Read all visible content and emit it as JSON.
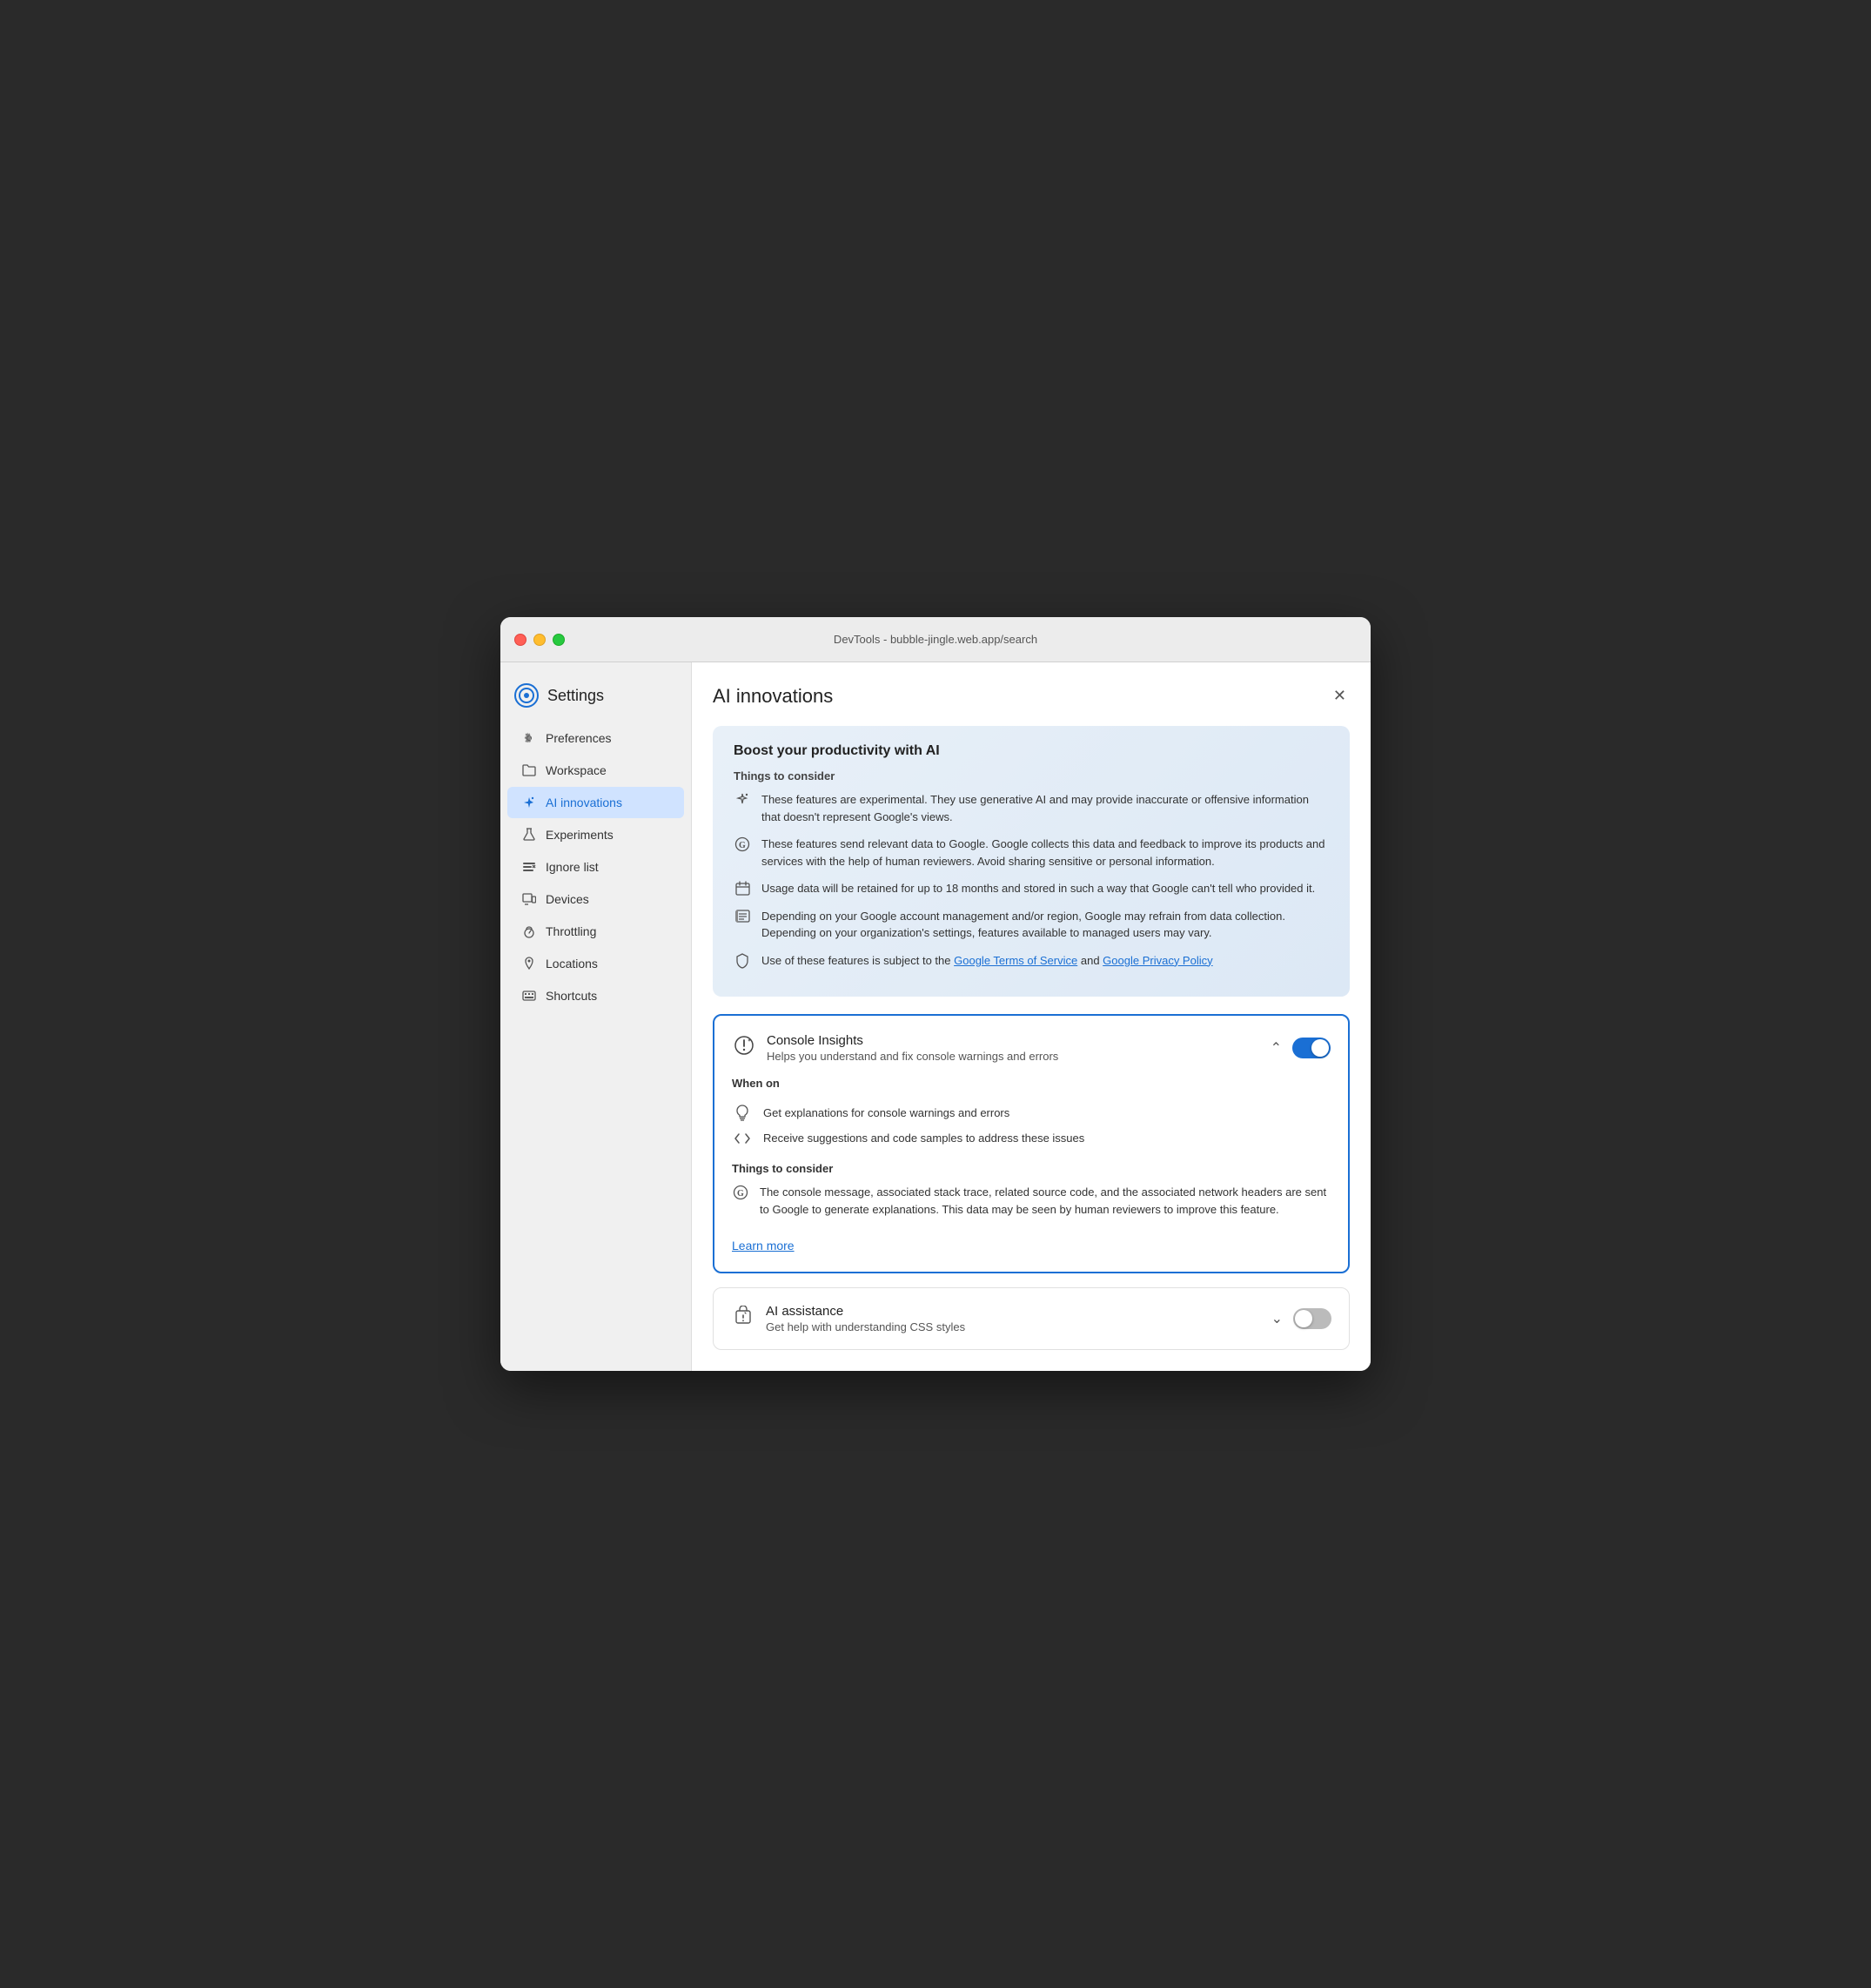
{
  "window": {
    "title": "DevTools - bubble-jingle.web.app/search"
  },
  "sidebar": {
    "heading": "Settings",
    "items": [
      {
        "id": "preferences",
        "label": "Preferences",
        "icon": "gear"
      },
      {
        "id": "workspace",
        "label": "Workspace",
        "icon": "folder"
      },
      {
        "id": "ai-innovations",
        "label": "AI innovations",
        "icon": "sparkle",
        "active": true
      },
      {
        "id": "experiments",
        "label": "Experiments",
        "icon": "flask"
      },
      {
        "id": "ignore-list",
        "label": "Ignore list",
        "icon": "ignore"
      },
      {
        "id": "devices",
        "label": "Devices",
        "icon": "devices"
      },
      {
        "id": "throttling",
        "label": "Throttling",
        "icon": "throttle"
      },
      {
        "id": "locations",
        "label": "Locations",
        "icon": "location"
      },
      {
        "id": "shortcuts",
        "label": "Shortcuts",
        "icon": "keyboard"
      }
    ]
  },
  "main": {
    "title": "AI innovations",
    "info_box": {
      "title": "Boost your productivity with AI",
      "things_to_consider": "Things to consider",
      "items": [
        {
          "text": "These features are experimental. They use generative AI and may provide inaccurate or offensive information that doesn't represent Google's views.",
          "icon": "sparkle-icon"
        },
        {
          "text": "These features send relevant data to Google. Google collects this data and feedback to improve its products and services with the help of human reviewers. Avoid sharing sensitive or personal information.",
          "icon": "google-icon"
        },
        {
          "text": "Usage data will be retained for up to 18 months and stored in such a way that Google can't tell who provided it.",
          "icon": "calendar-icon"
        },
        {
          "text": "Depending on your Google account management and/or region, Google may refrain from data collection. Depending on your organization's settings, features available to managed users may vary.",
          "icon": "list-icon"
        },
        {
          "text_parts": [
            "Use of these features is subject to the ",
            "Google Terms of Service",
            " and ",
            "Google Privacy Policy"
          ],
          "icon": "shield-icon"
        }
      ]
    },
    "console_insights": {
      "name": "Console Insights",
      "description": "Helps you understand and fix console warnings and errors",
      "enabled": true,
      "expanded": true,
      "when_on_title": "When on",
      "when_on_items": [
        {
          "text": "Get explanations for console warnings and errors",
          "icon": "bulb-icon"
        },
        {
          "text": "Receive suggestions and code samples to address these issues",
          "icon": "code-icon"
        }
      ],
      "things_to_consider_title": "Things to consider",
      "things_to_consider_text": "The console message, associated stack trace, related source code, and the associated network headers are sent to Google to generate explanations. This data may be seen by human reviewers to improve this feature.",
      "learn_more": "Learn more"
    },
    "ai_assistance": {
      "name": "AI assistance",
      "description": "Get help with understanding CSS styles",
      "enabled": false,
      "expanded": false
    }
  }
}
